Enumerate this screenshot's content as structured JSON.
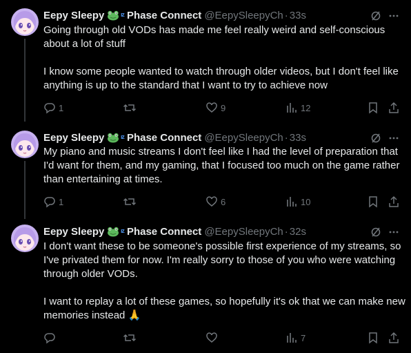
{
  "colors": {
    "background": "#000000",
    "text": "#e7e9ea",
    "muted": "#71767b",
    "thread_line": "#333639",
    "avatar_hair": "#b79be8",
    "avatar_face": "#fde8ec",
    "zzz": "#4a8fe7",
    "frog": "#5cb85c"
  },
  "tweets": [
    {
      "display_name": "Eepy Sleepy",
      "zzz": "ᶦᶻ",
      "affiliation": "Phase Connect",
      "handle": "@EepySleepyCh",
      "dot": "·",
      "time": "33s",
      "text": "Going through old VODs has made me feel really weird and self-conscious about a lot of stuff\n\nI know some people wanted to watch through older videos, but I don't feel like anything is up to the standard that I want to try to achieve now",
      "replies": "1",
      "retweets": "",
      "likes": "9",
      "views": "12",
      "icons": {
        "grok": "grok-icon",
        "more": "more-icon",
        "reply": "reply-icon",
        "retweet": "retweet-icon",
        "like": "heart-icon",
        "views": "views-icon",
        "bookmark": "bookmark-icon",
        "share": "share-icon"
      }
    },
    {
      "display_name": "Eepy Sleepy",
      "zzz": "ᶦᶻ",
      "affiliation": "Phase Connect",
      "handle": "@EepySleepyCh",
      "dot": "·",
      "time": "33s",
      "text": "My piano and music streams I don't feel like I had the level of preparation that I'd want for them, and my gaming, that I focused too much on the game rather than entertaining at times.",
      "replies": "1",
      "retweets": "",
      "likes": "6",
      "views": "10",
      "icons": {
        "grok": "grok-icon",
        "more": "more-icon",
        "reply": "reply-icon",
        "retweet": "retweet-icon",
        "like": "heart-icon",
        "views": "views-icon",
        "bookmark": "bookmark-icon",
        "share": "share-icon"
      }
    },
    {
      "display_name": "Eepy Sleepy",
      "zzz": "ᶦᶻ",
      "affiliation": "Phase Connect",
      "handle": "@EepySleepyCh",
      "dot": "·",
      "time": "32s",
      "text": "I don't want these to be someone's possible first experience of my streams, so I've privated them for now. I'm really sorry to those of you who were watching through older VODs.\n\nI want to replay a lot of these games, so hopefully it's ok that we can make new memories instead 🙏",
      "replies": "",
      "retweets": "",
      "likes": "",
      "views": "7",
      "icons": {
        "grok": "grok-icon",
        "more": "more-icon",
        "reply": "reply-icon",
        "retweet": "retweet-icon",
        "like": "heart-icon",
        "views": "views-icon",
        "bookmark": "bookmark-icon",
        "share": "share-icon"
      }
    }
  ]
}
